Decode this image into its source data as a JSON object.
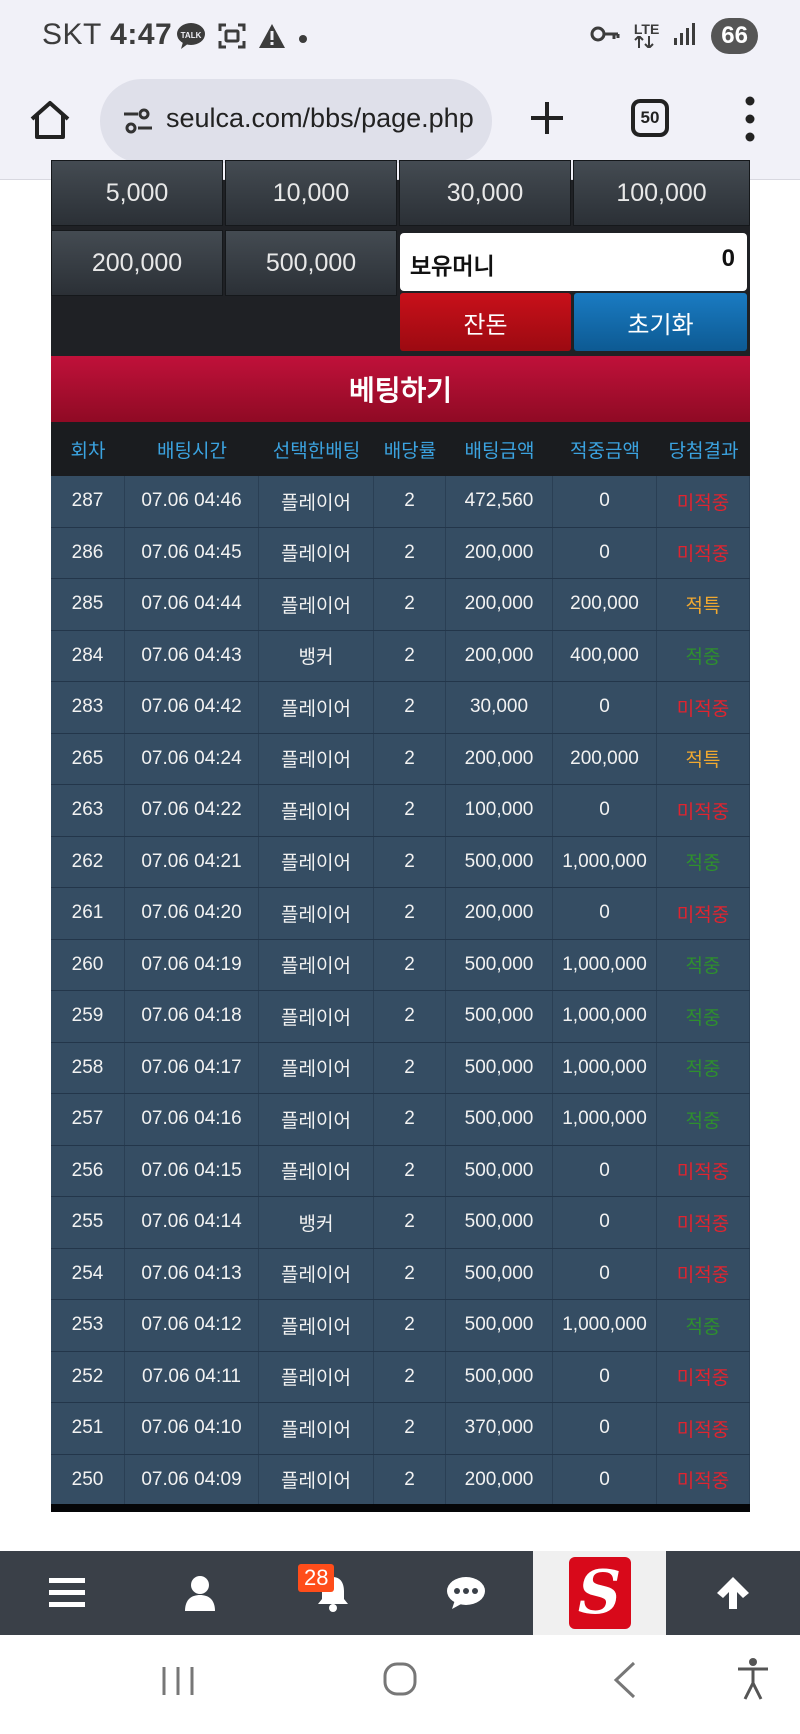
{
  "status_bar": {
    "carrier": "SKT",
    "time": "4:47",
    "talk_badge": "TALK",
    "network": "LTE",
    "battery": "66"
  },
  "browser": {
    "url": "seulca.com/bbs/page.php",
    "tab_count": "50"
  },
  "chips": {
    "row1": [
      "5,000",
      "10,000",
      "30,000",
      "100,000"
    ],
    "row2": [
      "200,000",
      "500,000"
    ]
  },
  "money": {
    "label": "보유머니",
    "value": "0"
  },
  "buttons": {
    "change": "잔돈",
    "reset": "초기화"
  },
  "bet_title": "베팅하기",
  "table": {
    "headers": [
      "회차",
      "배팅시간",
      "선택한배팅",
      "배당률",
      "배팅금액",
      "적중금액",
      "당첨결과"
    ],
    "rows": [
      [
        "287",
        "07.06 04:46",
        "플레이어",
        "2",
        "472,560",
        "0",
        "미적중"
      ],
      [
        "286",
        "07.06 04:45",
        "플레이어",
        "2",
        "200,000",
        "0",
        "미적중"
      ],
      [
        "285",
        "07.06 04:44",
        "플레이어",
        "2",
        "200,000",
        "200,000",
        "적특"
      ],
      [
        "284",
        "07.06 04:43",
        "뱅커",
        "2",
        "200,000",
        "400,000",
        "적중"
      ],
      [
        "283",
        "07.06 04:42",
        "플레이어",
        "2",
        "30,000",
        "0",
        "미적중"
      ],
      [
        "265",
        "07.06 04:24",
        "플레이어",
        "2",
        "200,000",
        "200,000",
        "적특"
      ],
      [
        "263",
        "07.06 04:22",
        "플레이어",
        "2",
        "100,000",
        "0",
        "미적중"
      ],
      [
        "262",
        "07.06 04:21",
        "플레이어",
        "2",
        "500,000",
        "1,000,000",
        "적중"
      ],
      [
        "261",
        "07.06 04:20",
        "플레이어",
        "2",
        "200,000",
        "0",
        "미적중"
      ],
      [
        "260",
        "07.06 04:19",
        "플레이어",
        "2",
        "500,000",
        "1,000,000",
        "적중"
      ],
      [
        "259",
        "07.06 04:18",
        "플레이어",
        "2",
        "500,000",
        "1,000,000",
        "적중"
      ],
      [
        "258",
        "07.06 04:17",
        "플레이어",
        "2",
        "500,000",
        "1,000,000",
        "적중"
      ],
      [
        "257",
        "07.06 04:16",
        "플레이어",
        "2",
        "500,000",
        "1,000,000",
        "적중"
      ],
      [
        "256",
        "07.06 04:15",
        "플레이어",
        "2",
        "500,000",
        "0",
        "미적중"
      ],
      [
        "255",
        "07.06 04:14",
        "뱅커",
        "2",
        "500,000",
        "0",
        "미적중"
      ],
      [
        "254",
        "07.06 04:13",
        "플레이어",
        "2",
        "500,000",
        "0",
        "미적중"
      ],
      [
        "253",
        "07.06 04:12",
        "플레이어",
        "2",
        "500,000",
        "1,000,000",
        "적중"
      ],
      [
        "252",
        "07.06 04:11",
        "플레이어",
        "2",
        "500,000",
        "0",
        "미적중"
      ],
      [
        "251",
        "07.06 04:10",
        "플레이어",
        "2",
        "370,000",
        "0",
        "미적중"
      ],
      [
        "250",
        "07.06 04:09",
        "플레이어",
        "2",
        "200,000",
        "0",
        "미적중"
      ]
    ]
  },
  "result_colors": {
    "미적중": "#e0242f",
    "적특": "#f0a830",
    "적중": "#2e8f2e"
  },
  "bottom_nav": {
    "notification_count": "28",
    "logo_letter": "S"
  }
}
